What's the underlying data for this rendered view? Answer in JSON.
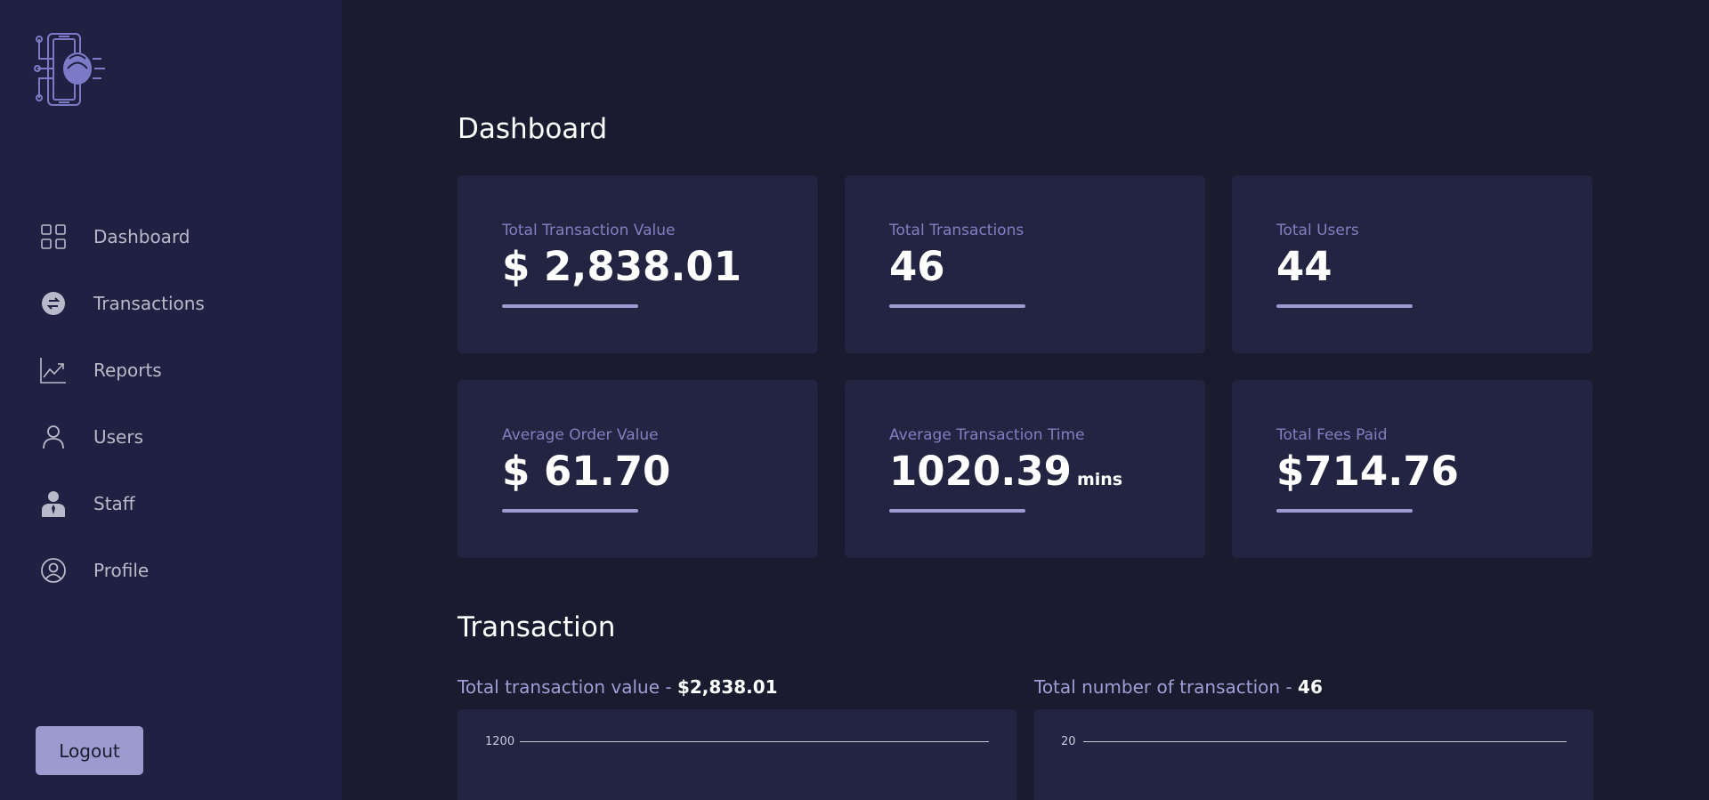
{
  "sidebar": {
    "logo_icon": "fingerprint-phone-logo",
    "items": [
      {
        "label": "Dashboard",
        "icon": "grid-icon"
      },
      {
        "label": "Transactions",
        "icon": "exchange-icon"
      },
      {
        "label": "Reports",
        "icon": "trend-chart-icon"
      },
      {
        "label": "Users",
        "icon": "user-icon"
      },
      {
        "label": "Staff",
        "icon": "staff-icon"
      },
      {
        "label": "Profile",
        "icon": "profile-circle-icon"
      }
    ],
    "logout_label": "Logout"
  },
  "dashboard": {
    "title": "Dashboard",
    "cards": [
      {
        "label": "Total Transaction Value",
        "value": "$ 2,838.01",
        "unit": ""
      },
      {
        "label": "Total Transactions",
        "value": "46",
        "unit": ""
      },
      {
        "label": "Total Users",
        "value": "44",
        "unit": ""
      },
      {
        "label": "Average Order Value",
        "value": "$ 61.70",
        "unit": ""
      },
      {
        "label": "Average Transaction Time",
        "value": "1020.39",
        "unit": "mins"
      },
      {
        "label": "Total Fees Paid",
        "value": "$714.76",
        "unit": ""
      }
    ]
  },
  "transaction": {
    "title": "Transaction",
    "charts": [
      {
        "caption_prefix": "Total transaction value - ",
        "caption_value": "$2,838.01",
        "top_tick": "1200"
      },
      {
        "caption_prefix": "Total number of transaction - ",
        "caption_value": "46",
        "top_tick": "20"
      }
    ]
  },
  "colors": {
    "background": "#1b1b2f",
    "sidebar": "#202142",
    "card": "#232442",
    "accent": "#9b9bcf",
    "label": "#8080c0"
  }
}
